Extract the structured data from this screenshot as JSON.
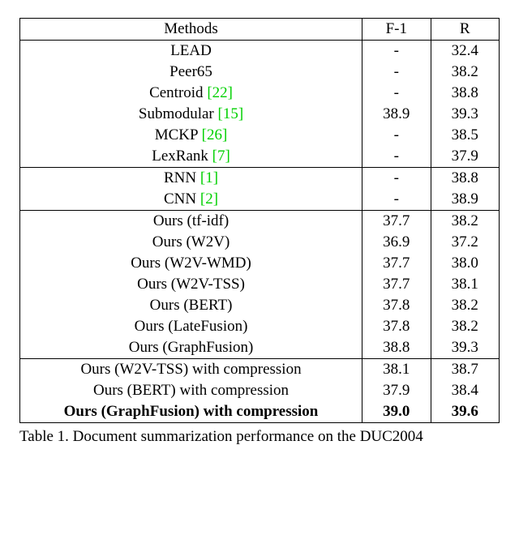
{
  "headers": {
    "methods": "Methods",
    "f1": "F-1",
    "r": "R"
  },
  "groups": [
    [
      {
        "method": "LEAD",
        "cite": "",
        "f1": "-",
        "r": "32.4"
      },
      {
        "method": "Peer65",
        "cite": "",
        "f1": "-",
        "r": "38.2"
      },
      {
        "method": "Centroid ",
        "cite": "[22]",
        "f1": "-",
        "r": "38.8"
      },
      {
        "method": "Submodular ",
        "cite": "[15]",
        "f1": "38.9",
        "r": "39.3"
      },
      {
        "method": "MCKP ",
        "cite": "[26]",
        "f1": "-",
        "r": "38.5"
      },
      {
        "method": "LexRank ",
        "cite": "[7]",
        "f1": "-",
        "r": "37.9"
      }
    ],
    [
      {
        "method": "RNN ",
        "cite": "[1]",
        "f1": "-",
        "r": "38.8"
      },
      {
        "method": "CNN ",
        "cite": "[2]",
        "f1": "-",
        "r": "38.9"
      }
    ],
    [
      {
        "method": "Ours (tf-idf)",
        "cite": "",
        "f1": "37.7",
        "r": "38.2"
      },
      {
        "method": "Ours (W2V)",
        "cite": "",
        "f1": "36.9",
        "r": "37.2"
      },
      {
        "method": "Ours (W2V-WMD)",
        "cite": "",
        "f1": "37.7",
        "r": "38.0"
      },
      {
        "method": "Ours (W2V-TSS)",
        "cite": "",
        "f1": "37.7",
        "r": "38.1"
      },
      {
        "method": "Ours (BERT)",
        "cite": "",
        "f1": "37.8",
        "r": "38.2"
      },
      {
        "method": "Ours (LateFusion)",
        "cite": "",
        "f1": "37.8",
        "r": "38.2"
      },
      {
        "method": "Ours (GraphFusion)",
        "cite": "",
        "f1": "38.8",
        "r": "39.3"
      }
    ],
    [
      {
        "method": "Ours (W2V-TSS) with compression",
        "cite": "",
        "f1": "38.1",
        "r": "38.7"
      },
      {
        "method": "Ours (BERT) with compression",
        "cite": "",
        "f1": "37.9",
        "r": "38.4"
      },
      {
        "method": "Ours (GraphFusion) with compression",
        "cite": "",
        "f1": "39.0",
        "r": "39.6",
        "bold": true
      }
    ]
  ],
  "caption": "Table 1. Document summarization performance on the DUC2004",
  "chart_data": {
    "type": "table",
    "title": "Document summarization performance on the DUC2004",
    "columns": [
      "Methods",
      "F-1",
      "R"
    ],
    "rows": [
      [
        "LEAD",
        null,
        32.4
      ],
      [
        "Peer65",
        null,
        38.2
      ],
      [
        "Centroid [22]",
        null,
        38.8
      ],
      [
        "Submodular [15]",
        38.9,
        39.3
      ],
      [
        "MCKP [26]",
        null,
        38.5
      ],
      [
        "LexRank [7]",
        null,
        37.9
      ],
      [
        "RNN [1]",
        null,
        38.8
      ],
      [
        "CNN [2]",
        null,
        38.9
      ],
      [
        "Ours (tf-idf)",
        37.7,
        38.2
      ],
      [
        "Ours (W2V)",
        36.9,
        37.2
      ],
      [
        "Ours (W2V-WMD)",
        37.7,
        38.0
      ],
      [
        "Ours (W2V-TSS)",
        37.7,
        38.1
      ],
      [
        "Ours (BERT)",
        37.8,
        38.2
      ],
      [
        "Ours (LateFusion)",
        37.8,
        38.2
      ],
      [
        "Ours (GraphFusion)",
        38.8,
        39.3
      ],
      [
        "Ours (W2V-TSS) with compression",
        38.1,
        38.7
      ],
      [
        "Ours (BERT) with compression",
        37.9,
        38.4
      ],
      [
        "Ours (GraphFusion) with compression",
        39.0,
        39.6
      ]
    ]
  }
}
